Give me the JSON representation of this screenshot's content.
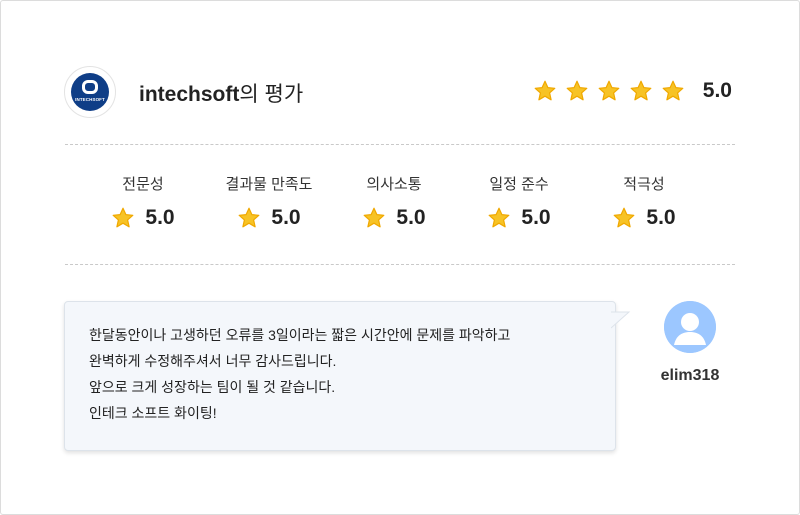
{
  "review": {
    "company_name": "intechsoft",
    "title_suffix": "의 평가",
    "logo_text": "INTECHSOFT",
    "overall_rating": 5.0,
    "overall_score_text": "5.0",
    "star_color": "#f5b800",
    "star_count": 5
  },
  "criteria": [
    {
      "label": "전문성",
      "score": "5.0"
    },
    {
      "label": "결과물 만족도",
      "score": "5.0"
    },
    {
      "label": "의사소통",
      "score": "5.0"
    },
    {
      "label": "일정 준수",
      "score": "5.0"
    },
    {
      "label": "적극성",
      "score": "5.0"
    }
  ],
  "comment": {
    "lines": [
      "한달동안이나 고생하던 오류를 3일이라는 짧은 시간안에 문제를 파악하고",
      "완벽하게 수정해주셔서 너무 감사드립니다.",
      "앞으로 크게 성장하는 팀이 될 것 같습니다.",
      "인테크 소프트 화이팅!"
    ]
  },
  "reviewer": {
    "username": "elim318",
    "avatar_icon": "user-avatar-icon",
    "avatar_color": "#9cc7ff"
  }
}
